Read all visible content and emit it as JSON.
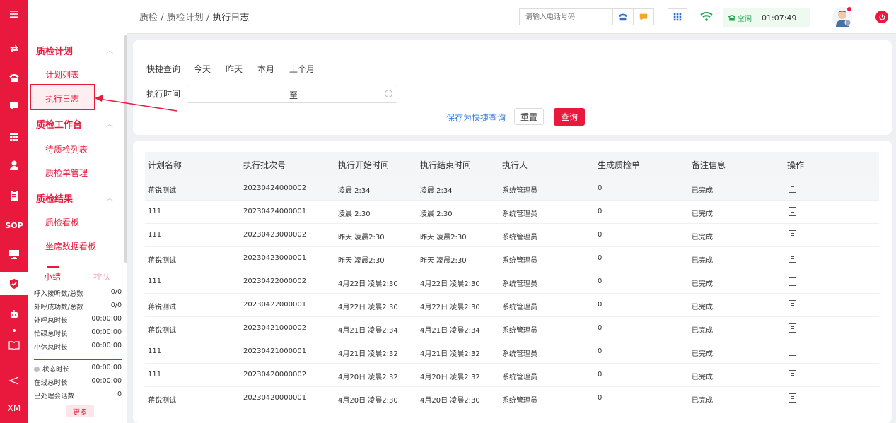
{
  "rail": {
    "items": [
      {
        "icon": "transfer-icon"
      },
      {
        "icon": "phone-icon"
      },
      {
        "icon": "chat-icon"
      },
      {
        "icon": "grid-icon"
      },
      {
        "icon": "user-icon"
      },
      {
        "icon": "clipboard-icon"
      },
      {
        "label": "SOP"
      },
      {
        "icon": "monitor-icon"
      },
      {
        "icon": "shield-check-icon",
        "active": true
      },
      {
        "icon": "robot-icon"
      },
      {
        "icon": "book-icon"
      },
      {
        "icon": "send-icon"
      },
      {
        "label": "XM"
      }
    ]
  },
  "sidebar": {
    "group1": {
      "label": "质检计划",
      "items": [
        "计划列表",
        "执行日志"
      ]
    },
    "group2": {
      "label": "质检工作台",
      "items": [
        "待质检列表",
        "质检单管理"
      ]
    },
    "group3": {
      "label": "质检结果",
      "items": [
        "质检看板",
        "坐席数据看板"
      ]
    }
  },
  "stats": {
    "tab_summary": "小结",
    "tab_queue": "排队",
    "rows": [
      {
        "label": "呼入接听数/总数",
        "value": "0/0"
      },
      {
        "label": "外呼成功数/总数",
        "value": "0/0"
      },
      {
        "label": "外呼总时长",
        "value": "00:00:00"
      },
      {
        "label": "忙碌总时长",
        "value": "00:00:00"
      },
      {
        "label": "小休总时长",
        "value": "00:00:00"
      },
      {
        "label": "状态时长",
        "value": "00:00:00"
      },
      {
        "label": "在线总时长",
        "value": "00:00:00"
      },
      {
        "label": "已处理会话数",
        "value": "0"
      }
    ],
    "more": "更多"
  },
  "header": {
    "breadcrumb": [
      "质检",
      "质检计划",
      "执行日志"
    ],
    "phone_placeholder": "请输入电话号码",
    "status_label": "空闲",
    "timer": "01:07:49",
    "colors": {
      "accent": "#e8193c",
      "status_green": "#1aa34a"
    }
  },
  "query": {
    "quick_label": "快捷查询",
    "quick_options": [
      "今天",
      "昨天",
      "本月",
      "上个月"
    ],
    "time_label": "执行时间",
    "range_sep": "至",
    "save_quick": "保存为快捷查询",
    "reset": "重置",
    "search": "查询"
  },
  "table": {
    "columns": [
      "计划名称",
      "执行批次号",
      "执行开始时间",
      "执行结束时间",
      "执行人",
      "生成质检单",
      "备注信息",
      "操作"
    ],
    "rows": [
      [
        "蒋锐测试",
        "20230424000002",
        "凌晨 2:34",
        "凌晨 2:34",
        "系统管理员",
        "0",
        "已完成"
      ],
      [
        "111",
        "20230424000001",
        "凌晨 2:30",
        "凌晨 2:30",
        "系统管理员",
        "0",
        "已完成"
      ],
      [
        "111",
        "20230423000002",
        "昨天 凌晨2:30",
        "昨天 凌晨2:30",
        "系统管理员",
        "0",
        "已完成"
      ],
      [
        "蒋锐测试",
        "20230423000001",
        "昨天 凌晨2:30",
        "昨天 凌晨2:30",
        "系统管理员",
        "0",
        "已完成"
      ],
      [
        "111",
        "20230422000002",
        "4月22日 凌晨2:30",
        "4月22日 凌晨2:30",
        "系统管理员",
        "0",
        "已完成"
      ],
      [
        "蒋锐测试",
        "20230422000001",
        "4月22日 凌晨2:30",
        "4月22日 凌晨2:30",
        "系统管理员",
        "0",
        "已完成"
      ],
      [
        "蒋锐测试",
        "20230421000002",
        "4月21日 凌晨2:34",
        "4月21日 凌晨2:34",
        "系统管理员",
        "0",
        "已完成"
      ],
      [
        "111",
        "20230421000001",
        "4月21日 凌晨2:32",
        "4月21日 凌晨2:32",
        "系统管理员",
        "0",
        "已完成"
      ],
      [
        "111",
        "20230420000002",
        "4月20日 凌晨2:32",
        "4月20日 凌晨2:32",
        "系统管理员",
        "0",
        "已完成"
      ],
      [
        "蒋锐测试",
        "20230420000001",
        "4月20日 凌晨2:30",
        "4月20日 凌晨2:30",
        "系统管理员",
        "0",
        "已完成"
      ]
    ],
    "action_icon": "document-icon"
  }
}
